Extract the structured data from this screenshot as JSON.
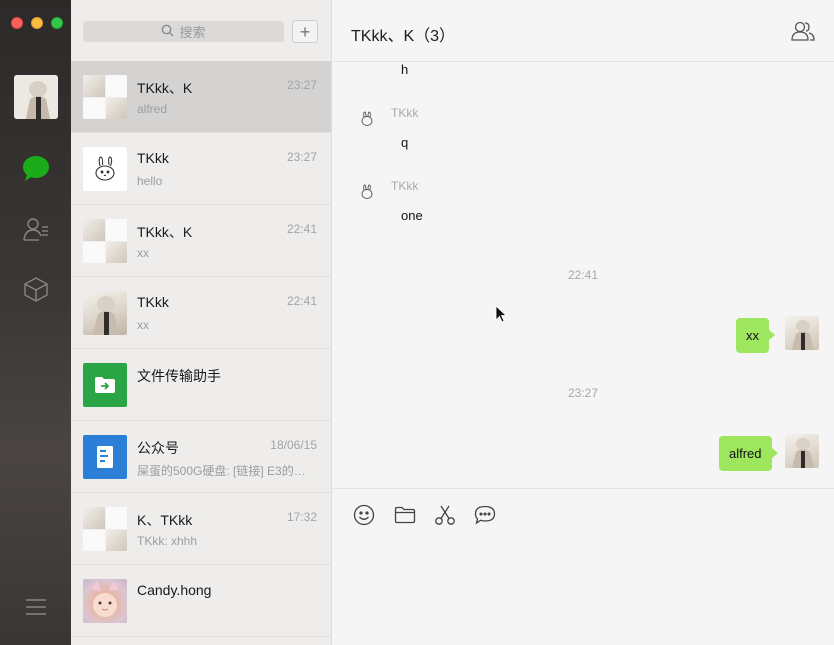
{
  "window": {
    "traffic_lights": [
      "close",
      "minimize",
      "maximize"
    ]
  },
  "rail": {
    "items": [
      {
        "icon": "chat-bubble-icon",
        "active": true
      },
      {
        "icon": "contacts-icon",
        "active": false
      },
      {
        "icon": "cube-icon",
        "active": false
      }
    ],
    "menu_icon": "hamburger-icon"
  },
  "search": {
    "placeholder": "搜索",
    "add_label": "+"
  },
  "conversations": [
    {
      "name": "TKkk、K",
      "time": "23:27",
      "preview": "alfred",
      "avatar": "group",
      "active": true
    },
    {
      "name": "TKkk",
      "time": "23:27",
      "preview": "hello",
      "avatar": "bunny",
      "active": false
    },
    {
      "name": "TKkk、K",
      "time": "22:41",
      "preview": "xx",
      "avatar": "group",
      "active": false
    },
    {
      "name": "TKkk",
      "time": "22:41",
      "preview": "xx",
      "avatar": "photo",
      "active": false
    },
    {
      "name": "文件传输助手",
      "time": "",
      "preview": "",
      "avatar": "file-transfer",
      "active": false
    },
    {
      "name": "公众号",
      "time": "18/06/15",
      "preview": "屎蛋的500G硬盘: [链接] E3的…",
      "avatar": "official-account",
      "active": false
    },
    {
      "name": "K、TKkk",
      "time": "17:32",
      "preview": "TKkk: xhhh",
      "avatar": "group",
      "active": false
    },
    {
      "name": "Candy.hong",
      "time": "",
      "preview": "",
      "avatar": "candy",
      "active": false
    }
  ],
  "chat": {
    "title": "TKkk、K（3）",
    "messages": [
      {
        "sender": "",
        "text": "h"
      },
      {
        "sender": "TKkk",
        "text": "q"
      },
      {
        "sender": "TKkk",
        "text": "one"
      },
      {
        "timestamp": "22:41"
      },
      {
        "sender": "me",
        "text": "xx"
      },
      {
        "timestamp": "23:27"
      },
      {
        "sender": "me",
        "text": "alfred"
      }
    ],
    "ts1": "22:41",
    "ts2": "23:27",
    "msg_h": "h",
    "msg_q_sender": "TKkk",
    "msg_q": "q",
    "msg_one_sender": "TKkk",
    "msg_one": "one",
    "my_msg_1": "xx",
    "my_msg_2": "alfred"
  },
  "composer": {
    "tools": [
      "emoji-icon",
      "folder-icon",
      "scissors-icon",
      "chat-history-icon"
    ]
  },
  "colors": {
    "rail": "#2c2a29",
    "my_bubble": "#9ee65e",
    "active_row": "#d4d3d2",
    "chat_icon_green": "#1aad19"
  }
}
